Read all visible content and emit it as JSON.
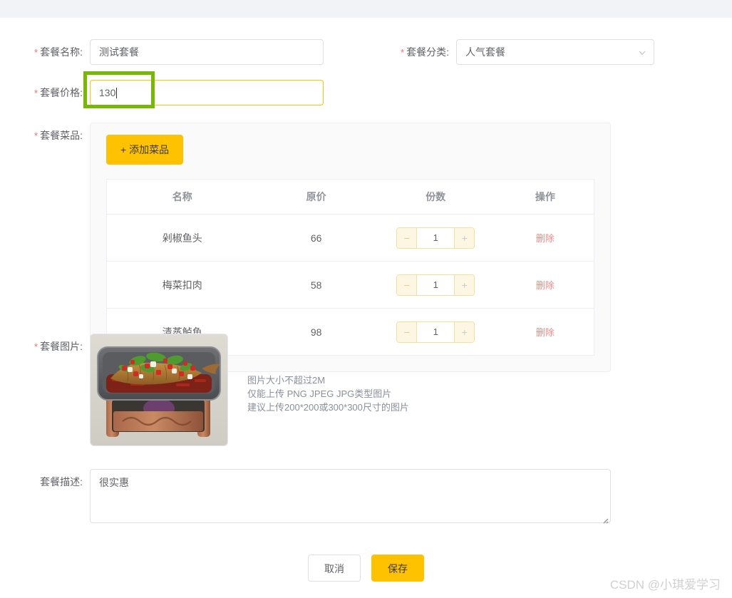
{
  "form": {
    "name_label": "套餐名称:",
    "name_value": "测试套餐",
    "category_label": "套餐分类:",
    "category_value": "人气套餐",
    "price_label": "套餐价格:",
    "price_value": "130",
    "dishes_label": "套餐菜品:",
    "image_label": "套餐图片:",
    "description_label": "套餐描述:",
    "description_value": "很实惠",
    "required_mark": "*"
  },
  "dishes": {
    "add_button_label": "+ 添加菜品",
    "columns": [
      "名称",
      "原价",
      "份数",
      "操作"
    ],
    "rows": [
      {
        "name": "剁椒鱼头",
        "price": "66",
        "qty": "1",
        "action": "删除"
      },
      {
        "name": "梅菜扣肉",
        "price": "58",
        "qty": "1",
        "action": "删除"
      },
      {
        "name": "清蒸鲈鱼",
        "price": "98",
        "qty": "1",
        "action": "删除"
      }
    ],
    "stepper": {
      "minus": "−",
      "plus": "+"
    }
  },
  "upload": {
    "hint_line1": "图片大小不超过2M",
    "hint_line2": "仅能上传 PNG JPEG JPG类型图片",
    "hint_line3": "建议上传200*200或300*300尺寸的图片"
  },
  "footer": {
    "cancel_label": "取消",
    "save_label": "保存"
  },
  "watermark": {
    "text": "CSDN @小琪爱学习"
  },
  "colors": {
    "accent": "#ffc200",
    "required": "#f56c6c",
    "delete": "#f78989",
    "annotation": "#76b900",
    "topbar": "#f2f3f7"
  }
}
